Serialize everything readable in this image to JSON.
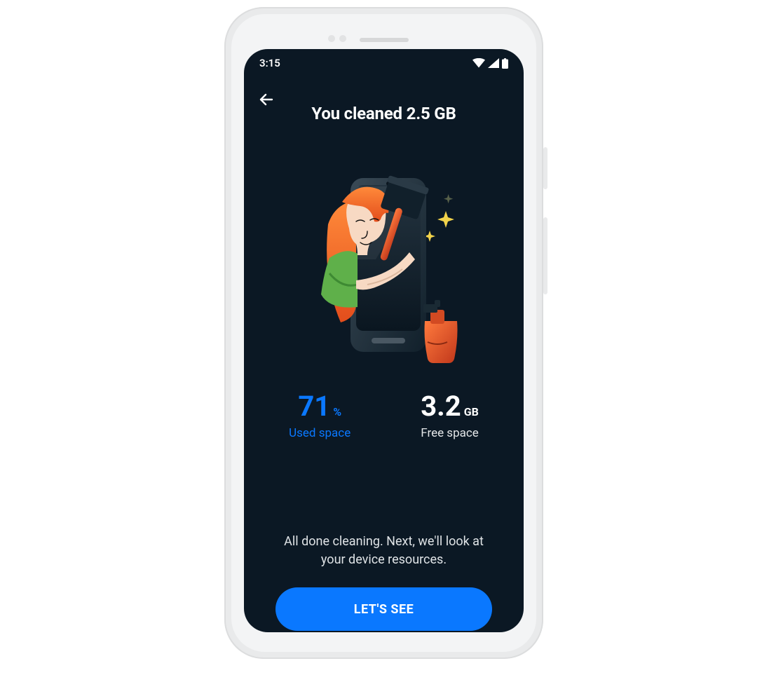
{
  "status": {
    "time": "3:15"
  },
  "header": {
    "title": "You cleaned 2.5 GB"
  },
  "stats": {
    "used": {
      "value": "71",
      "unit": "%",
      "label": "Used space"
    },
    "free": {
      "value": "3.2",
      "unit": "GB",
      "label": "Free space"
    }
  },
  "footer": {
    "message": "All done cleaning. Next, we'll look at your device resources.",
    "cta": "LET'S SEE"
  },
  "colors": {
    "accent": "#0a78ff",
    "bg": "#0b1824"
  }
}
